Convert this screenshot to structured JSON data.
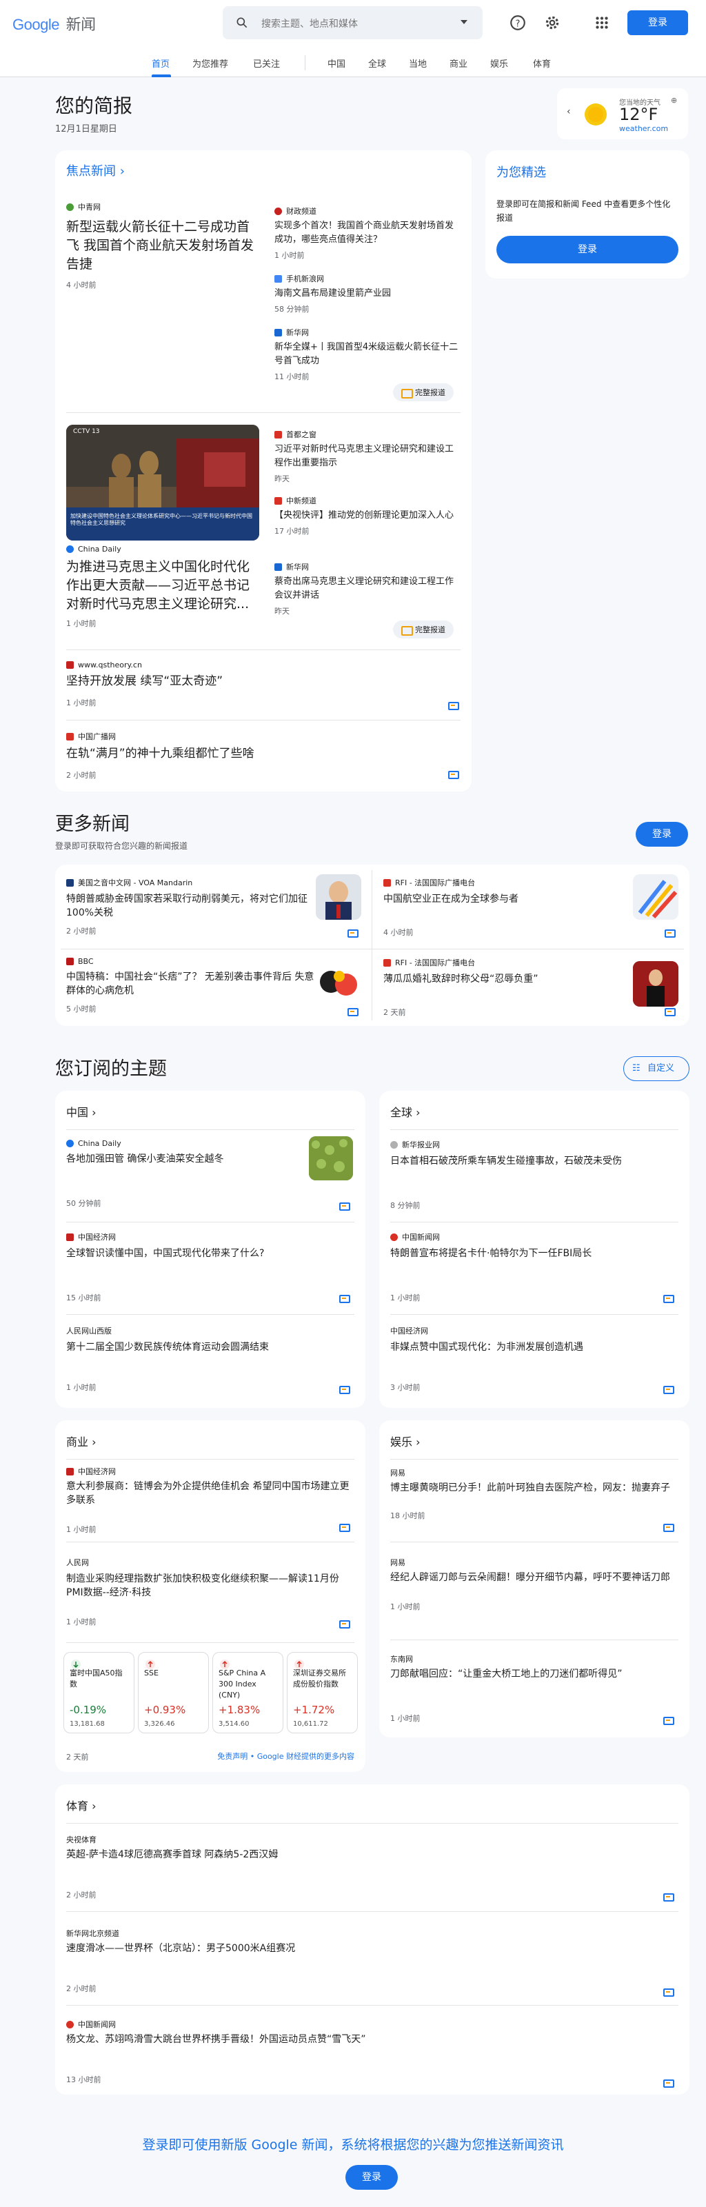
{
  "header": {
    "logo_google": "Google",
    "logo_news": "新闻",
    "search_placeholder": "搜索主题、地点和媒体",
    "signin": "登录"
  },
  "nav": {
    "tabs": [
      "首页",
      "为您推荐",
      "已关注",
      "中国",
      "全球",
      "当地",
      "商业",
      "娱乐",
      "体育"
    ]
  },
  "briefing": {
    "title": "您的简报",
    "date": "12月1日星期日"
  },
  "weather": {
    "label": "您当地的天气",
    "temp": "12°F",
    "source": "weather.com"
  },
  "top_stories": {
    "heading": "焦点新闻",
    "full_coverage": "完整报道",
    "cluster1": {
      "main": {
        "source": "中青网",
        "headline": "新型运载火箭长征十二号成功首飞 我国首个商业航天发射场首发告捷",
        "time": "4 小时前"
      },
      "side": [
        {
          "source": "财政频道",
          "headline": "实现多个首次！我国首个商业航天发射场首发成功，哪些亮点值得关注？",
          "time": "1 小时前"
        },
        {
          "source": "手机新浪网",
          "headline": "海南文昌布局建设里箭产业园",
          "time": "58 分钟前"
        },
        {
          "source": "新华网",
          "headline": "新华全媒+丨我国首型4米级运载火箭长征十二号首飞成功",
          "time": "11 小时前"
        }
      ]
    },
    "cluster2": {
      "image_caption": "加快建设中国特色社会主义理论体系研究中心——习近平书记与新时代中国特色社会主义思想研究",
      "main": {
        "source": "China Daily",
        "headline": "为推进马克思主义中国化时代化作出更大贡献——习近平总书记对新时代马克思主义理论研究...",
        "time": "1 小时前"
      },
      "side": [
        {
          "source": "首都之窗",
          "headline": "习近平对新时代马克思主义理论研究和建设工程作出重要指示",
          "time": "昨天"
        },
        {
          "source": "中新频道",
          "headline": "【央视快评】推动党的创新理论更加深入人心",
          "time": "17 小时前"
        },
        {
          "source": "新华网",
          "headline": "蔡奇出席马克思主义理论研究和建设工程工作会议并讲话",
          "time": "昨天"
        }
      ]
    },
    "singles": [
      {
        "source": "www.qstheory.cn",
        "headline": "坚持开放发展 续写“亚太奇迹”",
        "time": "1 小时前"
      },
      {
        "source": "中国广播网",
        "headline": "在轨“满月”的神十九乘组都忙了些啥",
        "time": "2 小时前"
      }
    ]
  },
  "picks": {
    "title": "为您精选",
    "text": "登录即可在简报和新闻 Feed 中查看更多个性化报道",
    "signin": "登录"
  },
  "more_news": {
    "title": "更多新闻",
    "subtitle": "登录即可获取符合您兴趣的新闻报道",
    "signin": "登录",
    "items": [
      {
        "source": "美国之音中文网 - VOA Mandarin",
        "headline": "特朗普威胁金砖国家若采取行动削弱美元，将对它们加征100%关税",
        "time": "2 小时前"
      },
      {
        "source": "RFI - 法国国际广播电台",
        "headline": "中国航空业正在成为全球参与者",
        "time": "4 小时前"
      },
      {
        "source": "BBC",
        "headline": "中国特稿：中国社会“长痞”了？ 无差别袭击事件背后 失意群体的心病危机",
        "time": "5 小时前"
      },
      {
        "source": "RFI - 法国国际广播电台",
        "headline": "薄瓜瓜婚礼致辞时称父母“忍辱负重”",
        "time": "2 天前"
      }
    ]
  },
  "topics": {
    "title": "您订阅的主题",
    "customize": "自定义",
    "china": {
      "title": "中国",
      "items": [
        {
          "source": "China Daily",
          "headline": "各地加强田管 确保小麦油菜安全越冬",
          "time": "50 分钟前"
        },
        {
          "source": "中国经济网",
          "headline": "全球智识读懂中国，中国式现代化带来了什么?",
          "time": "15 小时前"
        },
        {
          "source": "人民网山西版",
          "headline": "第十二届全国少数民族传统体育运动会圆满结束",
          "time": "1 小时前"
        }
      ]
    },
    "world": {
      "title": "全球",
      "items": [
        {
          "source": "新华报业网",
          "headline": "日本首相石破茂所乘车辆发生碰撞事故，石破茂未受伤",
          "time": "8 分钟前"
        },
        {
          "source": "中国新闻网",
          "headline": "特朗普宣布将提名卡什·帕特尔为下一任FBI局长",
          "time": "1 小时前"
        },
        {
          "source": "中国经济网",
          "headline": "非媒点赞中国式现代化：为非洲发展创造机遇",
          "time": "3 小时前"
        }
      ]
    },
    "business": {
      "title": "商业",
      "items": [
        {
          "source": "中国经济网",
          "headline": "意大利参展商：链博会为外企提供绝佳机会 希望同中国市场建立更多联系",
          "time": "1 小时前"
        },
        {
          "source": "人民网",
          "headline": "制造业采购经理指数扩张加快积极变化继续积聚——解读11月份PMI数据--经济·科技",
          "time": "1 小时前"
        }
      ],
      "quotes": [
        {
          "name": "富时中国A50指数",
          "change": "-0.19%",
          "value": "13,181.68",
          "dir": "down"
        },
        {
          "name": "SSE",
          "change": "+0.93%",
          "value": "3,326.46",
          "dir": "up"
        },
        {
          "name": "S&P China A 300 Index (CNY)",
          "change": "+1.83%",
          "value": "3,514.60",
          "dir": "up"
        },
        {
          "name": "深圳证券交易所成份股价指数",
          "change": "+1.72%",
          "value": "10,611.72",
          "dir": "up"
        }
      ],
      "quotes_time": "2 天前",
      "disclaimer": "免责声明 • Google 财经提供的更多内容"
    },
    "entertainment": {
      "title": "娱乐",
      "items": [
        {
          "source": "网易",
          "headline": "博主曝黄晓明已分手！此前叶珂独自去医院产检，网友：抛妻弃子",
          "time": "18 小时前"
        },
        {
          "source": "网易",
          "headline": "经纪人辟谣刀郎与云朵闹翻！曝分开细节内幕，呼吁不要神话刀郎",
          "time": "1 小时前"
        },
        {
          "source": "东南网",
          "headline": "刀郎献唱回应：“让重金大桥工地上的刀迷们都听得见”",
          "time": "1 小时前"
        }
      ]
    },
    "sports": {
      "title": "体育",
      "items": [
        {
          "source": "央视体育",
          "headline": "英超-萨卡造4球厄德高赛季首球 阿森纳5-2西汉姆",
          "time": "2 小时前"
        },
        {
          "source": "新华网北京频道",
          "headline": "速度滑冰——世界杯（北京站）：男子5000米A组赛况",
          "time": "2 小时前"
        },
        {
          "source": "中国新闻网",
          "headline": "杨文龙、苏翊鸣滑雪大跳台世界杯携手晋级！外国运动员点赞“雪飞天”",
          "time": "13 小时前"
        }
      ]
    }
  },
  "footer": {
    "text": "登录即可使用新版 Google 新闻，系统将根据您的兴趣为您推送新闻资讯",
    "signin": "登录"
  }
}
